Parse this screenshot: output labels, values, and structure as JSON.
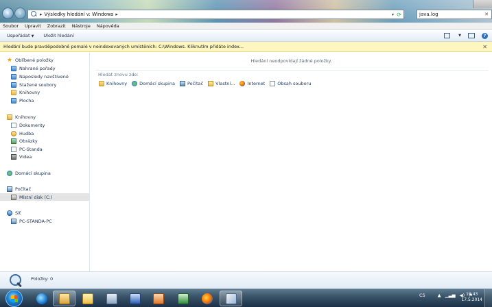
{
  "address_bar": {
    "breadcrumb": "Výsledky hledání v: Windows",
    "search_value": "java.log"
  },
  "menu": [
    "Soubor",
    "Upravit",
    "Zobrazit",
    "Nástroje",
    "Nápověda"
  ],
  "commands": {
    "organize": "Uspořádat",
    "save_search": "Uložit hledání"
  },
  "infobar": {
    "text": "Hledání bude pravděpodobně pomalé v neindexovaných umístěních: C:\\Windows. Kliknutím přidáte index..."
  },
  "nav": {
    "favorites": "Oblíbené položky",
    "recent_places": "Nahrané pořady",
    "recent": "Naposledy navštívené",
    "downloads": "Stažené soubory",
    "libraries_fav": "Knihovny",
    "desktop": "Plocha",
    "libraries": "Knihovny",
    "documents": "Dokumenty",
    "music": "Hudba",
    "pictures": "Obrázky",
    "pc_standa": "PC-Standa",
    "videos": "Videa",
    "homegroup": "Domácí skupina",
    "computer": "Počítač",
    "local_disk": "Místní disk (C:)",
    "network": "Síť",
    "network_pc": "PC-STANDA-PC"
  },
  "main": {
    "no_results": "Hledání neodpovídají žádné položky.",
    "search_again": "Hledat znovu zde:",
    "locations": [
      "Knihovny",
      "Domácí skupina",
      "Počítač",
      "Vlastní...",
      "Internet",
      "Obsah souboru"
    ]
  },
  "status": {
    "items": "Položky: 0"
  },
  "taskbar": {
    "language": "CS",
    "time": "19:43",
    "date": "17.5.2014"
  }
}
